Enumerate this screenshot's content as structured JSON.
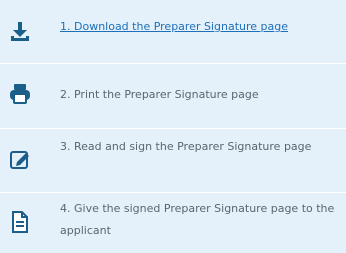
{
  "steps": [
    {
      "icon": "download-icon",
      "label": "1. Download the Preparer Signature page"
    },
    {
      "icon": "printer-icon",
      "label": "2. Print the Preparer Signature page"
    },
    {
      "icon": "edit-sign-icon",
      "label": "3. Read and sign the Preparer Signature page"
    },
    {
      "icon": "document-icon",
      "label": "4. Give the signed Preparer Signature page to the applicant"
    }
  ],
  "colors": {
    "background": "#e4f1fb",
    "icon": "#1b5e8a",
    "link": "#1f6fb8",
    "text": "#5b6570"
  }
}
